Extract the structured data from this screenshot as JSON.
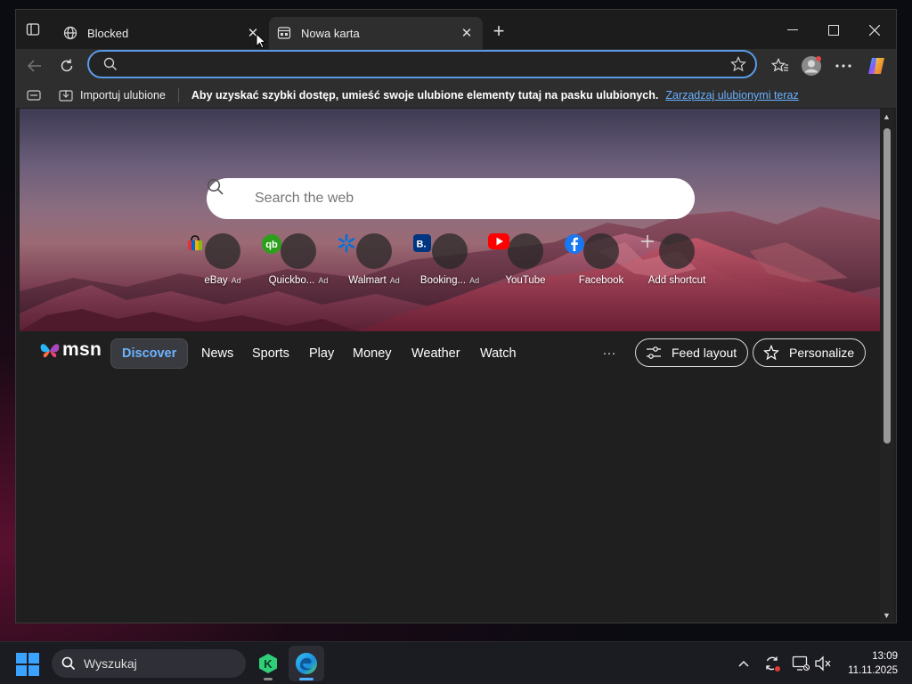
{
  "browser": {
    "tabs": [
      {
        "title": "Blocked",
        "icon": "globe-icon",
        "active": false
      },
      {
        "title": "Nowa karta",
        "icon": "newtab-page-icon",
        "active": true
      }
    ],
    "address": {
      "value": "",
      "placeholder": ""
    },
    "favorites_bar": {
      "import_label": "Importuj ulubione",
      "message": "Aby uzyskać szybki dostęp, umieść swoje ulubione elementy tutaj na pasku ulubionych.",
      "manage_link": "Zarządzaj ulubionymi teraz"
    }
  },
  "newtab": {
    "search_placeholder": "Search the web",
    "ad_label": "Ad",
    "shortcuts": [
      {
        "label": "eBay",
        "ad": true,
        "icon": "ebay-icon"
      },
      {
        "label": "Quickbo...",
        "ad": true,
        "icon": "quickbooks-icon"
      },
      {
        "label": "Walmart",
        "ad": true,
        "icon": "walmart-icon"
      },
      {
        "label": "Booking...",
        "ad": true,
        "icon": "booking-icon"
      },
      {
        "label": "YouTube",
        "ad": false,
        "icon": "youtube-icon"
      },
      {
        "label": "Facebook",
        "ad": false,
        "icon": "facebook-icon"
      },
      {
        "label": "Add shortcut",
        "ad": false,
        "icon": "plus-icon"
      }
    ],
    "msn": {
      "logo": "msn",
      "nav": [
        "Discover",
        "News",
        "Sports",
        "Play",
        "Money",
        "Weather",
        "Watch"
      ],
      "active_nav": "Discover",
      "more": "···",
      "feed_layout": "Feed layout",
      "personalize": "Personalize"
    }
  },
  "taskbar": {
    "search_placeholder": "Wyszukaj",
    "time": "13:09",
    "date": "11.11.2025"
  },
  "colors": {
    "accent": "#5b9be6",
    "link": "#6ab0ff",
    "active_nav": "#6db3ff"
  }
}
